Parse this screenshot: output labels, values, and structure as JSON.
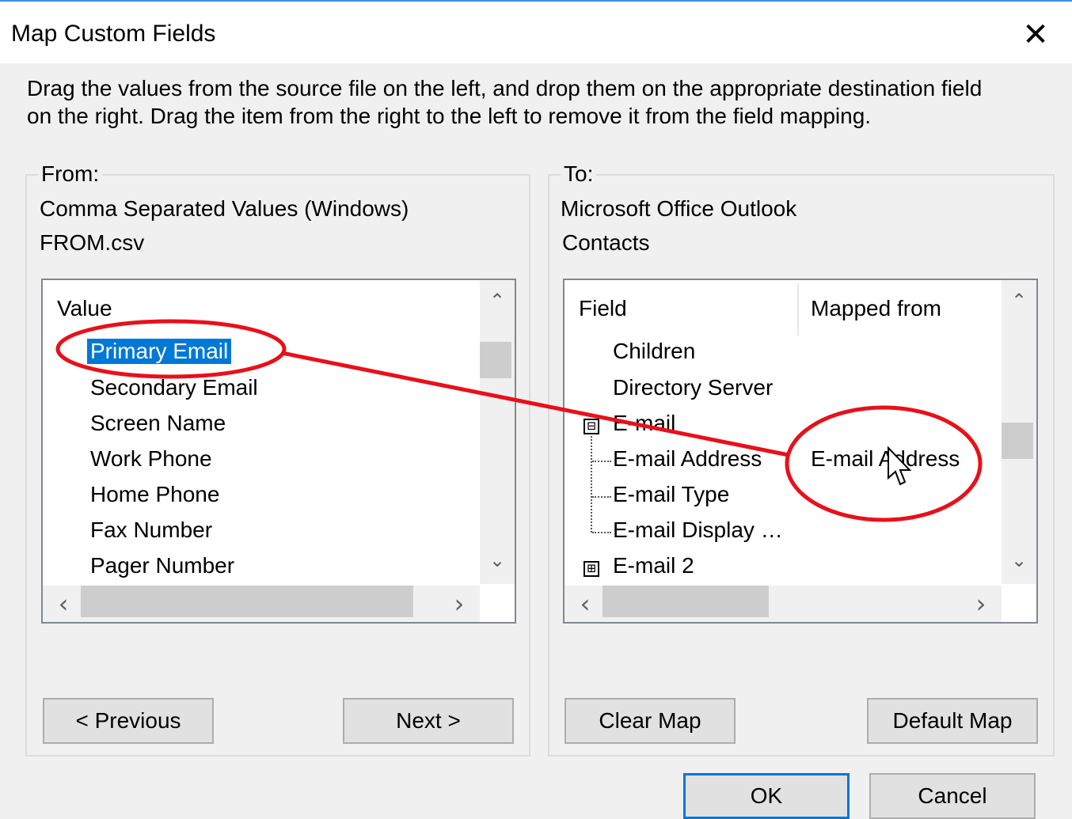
{
  "dialog": {
    "title": "Map Custom Fields",
    "close_glyph": "✕",
    "instructions_line1": "Drag the values from the source file on the left, and drop them on the appropriate destination field",
    "instructions_line2": "on the right.  Drag the item from the right to the left to remove it from the field mapping."
  },
  "from": {
    "legend": "From:",
    "source_type": "Comma Separated Values (Windows)",
    "file_name": "FROM.csv",
    "column_header": "Value",
    "items": [
      "Primary Email",
      "Secondary Email",
      "Screen Name",
      "Work Phone",
      "Home Phone",
      "Fax Number",
      "Pager Number"
    ],
    "selected_item": "Primary Email"
  },
  "to": {
    "legend": "To:",
    "app_name": "Microsoft Office Outlook",
    "folder": "Contacts",
    "column_field": "Field",
    "column_mapped": "Mapped from",
    "rows": [
      {
        "field": "Children",
        "mapped": ""
      },
      {
        "field": "Directory Server",
        "mapped": ""
      },
      {
        "field": "E-mail",
        "mapped": "",
        "expander": "⊟"
      },
      {
        "field": "E-mail Address",
        "mapped": "E-mail Address"
      },
      {
        "field": "E-mail Type",
        "mapped": ""
      },
      {
        "field": "E-mail Display …",
        "mapped": ""
      },
      {
        "field": "E-mail 2",
        "mapped": "",
        "expander": "⊞"
      }
    ]
  },
  "scroll": {
    "up": "⌃",
    "down": "⌄",
    "left": "‹",
    "right": "›"
  },
  "buttons": {
    "previous": "< Previous",
    "next": "Next >",
    "clear_map": "Clear Map",
    "default_map": "Default Map",
    "ok": "OK",
    "cancel": "Cancel"
  },
  "colors": {
    "selection": "#0078d7",
    "annotation": "#e8101a",
    "title_accent": "#3c8edb"
  }
}
